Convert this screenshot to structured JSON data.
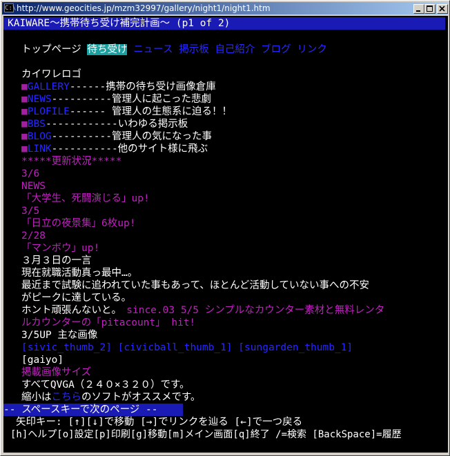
{
  "window": {
    "title": "http://www.geocities.jp/mzm32997/gallery/night1/night1.htm",
    "app_icon_label": "C:\\"
  },
  "header": "KAIWARE～携帯待ち受け補完計画～ (p1 of 2)",
  "nav": {
    "items": [
      "トップページ",
      "待ち受け",
      "ニュース",
      "掲示板",
      "自己紹介",
      "ブログ",
      "リンク"
    ]
  },
  "logo_text": "カイワレロゴ",
  "menu": [
    {
      "link": "GALLERY",
      "desc": "------携帯の待ち受け画像倉庫"
    },
    {
      "link": "NEWS",
      "desc": "----------管理人に起こった悲劇"
    },
    {
      "link": "PLOFILE",
      "desc": "------ 管理人の生態系に迫る！！"
    },
    {
      "link": "BBS",
      "desc": "------------いわゆる掲示板"
    },
    {
      "link": "BLOG",
      "desc": "----------管理人の気になった事"
    },
    {
      "link": "LINK",
      "desc": "-----------他のサイト様に飛ぶ"
    }
  ],
  "updates": {
    "heading": "*****更新状況*****",
    "lines": [
      "3/6",
      "NEWS",
      "「大学生、死闘演じる」up!",
      "3/5",
      "「日立の夜景集」6枚up!",
      "2/28",
      "「マンボウ」up!"
    ]
  },
  "daily": {
    "title": "３月３日の一言",
    "l1": "現在就職活動真っ最中…。",
    "l2": "最近まで試験に追われていた事もあって、ほとんど活動していない事への不安",
    "l3": "がピークに達している。",
    "l4": "ホント頑張んないと。",
    "since1": "since.03 5/5 シンプルなカウンター素材と無料レンタ",
    "since2": "ルカウンターの「pitacount」 hit!"
  },
  "images": {
    "heading": "3/5UP 主な画像",
    "thumbs": [
      "[sivic_thumb_2]",
      "[civicball_thumb_1]",
      "[sungarden_thumb_1]"
    ],
    "gaiyo": "[gaiyo]",
    "size_title": "掲載画像サイズ",
    "size_line": "すべてQVGA（２４０×３２０）です。",
    "shrink_pre": "縮小は",
    "shrink_link": "こちら",
    "shrink_post": "のソフトがオススメです。"
  },
  "status": {
    "next_page": "-- スペースキーで次のページ --",
    "help1": "矢印キー: [↑][↓]で移動 [→]でリンクを辿る [←]で一つ戻る",
    "help2": "[h]ヘルプ[o]設定[p]印刷[g]移動[m]メイン画面[q]終了 /=検索 [BackSpace]=履歴"
  },
  "colors": {
    "link": "#2828ff",
    "visited": "#c020c0",
    "selected_bg": "#1aa0a0",
    "status_bg": "#1a1ab4",
    "terminal_bg": "#000000"
  }
}
